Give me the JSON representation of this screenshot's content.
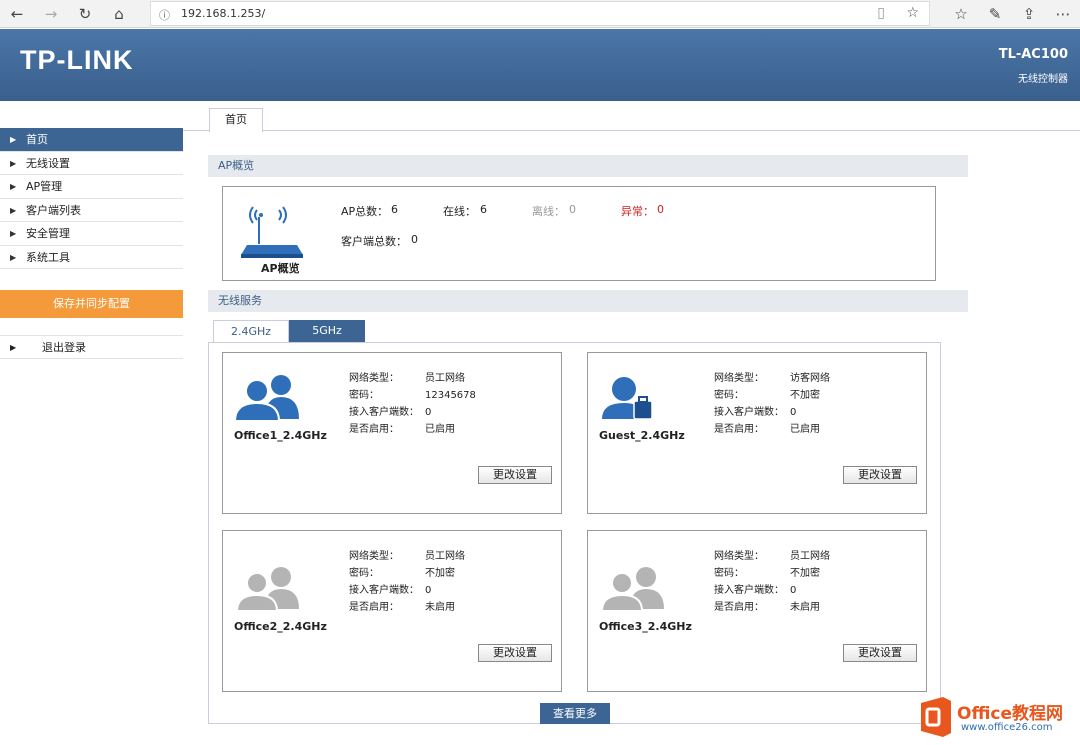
{
  "browser": {
    "url": "192.168.1.253/"
  },
  "header": {
    "logo": "TP-LINK",
    "model": "TL-AC100",
    "subtitle": "无线控制器"
  },
  "sidebar": {
    "items": [
      {
        "label": "首页"
      },
      {
        "label": "无线设置"
      },
      {
        "label": "AP管理"
      },
      {
        "label": "客户端列表"
      },
      {
        "label": "安全管理"
      },
      {
        "label": "系统工具"
      }
    ],
    "save": "保存并同步配置",
    "logout": "退出登录"
  },
  "main": {
    "tab": "首页",
    "ap_section": "AP概览",
    "ap": {
      "icon_label": "AP概览",
      "total_label": "AP总数：",
      "total": "6",
      "online_label": "在线：",
      "online": "6",
      "offline_label": "离线：",
      "offline": "0",
      "abnormal_label": "异常：",
      "abnormal": "0",
      "clients_label": "客户端总数：",
      "clients": "0"
    },
    "wireless_section": "无线服务",
    "band_tabs": [
      "2.4GHz",
      "5GHz"
    ],
    "field_labels": [
      "网络类型：",
      "密码：",
      "接入客户端数：",
      "是否启用："
    ],
    "button": "更改设置",
    "cards": [
      {
        "ssid": "Office1_2.4GHz",
        "type": "员工网络",
        "password": "12345678",
        "clients": "0",
        "enabled": "已启用"
      },
      {
        "ssid": "Guest_2.4GHz",
        "type": "访客网络",
        "password": "不加密",
        "clients": "0",
        "enabled": "已启用"
      },
      {
        "ssid": "Office2_2.4GHz",
        "type": "员工网络",
        "password": "不加密",
        "clients": "0",
        "enabled": "未启用"
      },
      {
        "ssid": "Office3_2.4GHz",
        "type": "员工网络",
        "password": "不加密",
        "clients": "0",
        "enabled": "未启用"
      }
    ],
    "more": "查看更多"
  },
  "watermark": {
    "brand": "Office教程网",
    "url": "www.office26.com"
  },
  "colors": {
    "header": "#3f6a9a",
    "active_nav": "#3d6594",
    "save": "#f59a3a",
    "abnormal": "#cc2222",
    "icon_blue": "#2f6fba",
    "icon_gray": "#b4b4b4"
  }
}
